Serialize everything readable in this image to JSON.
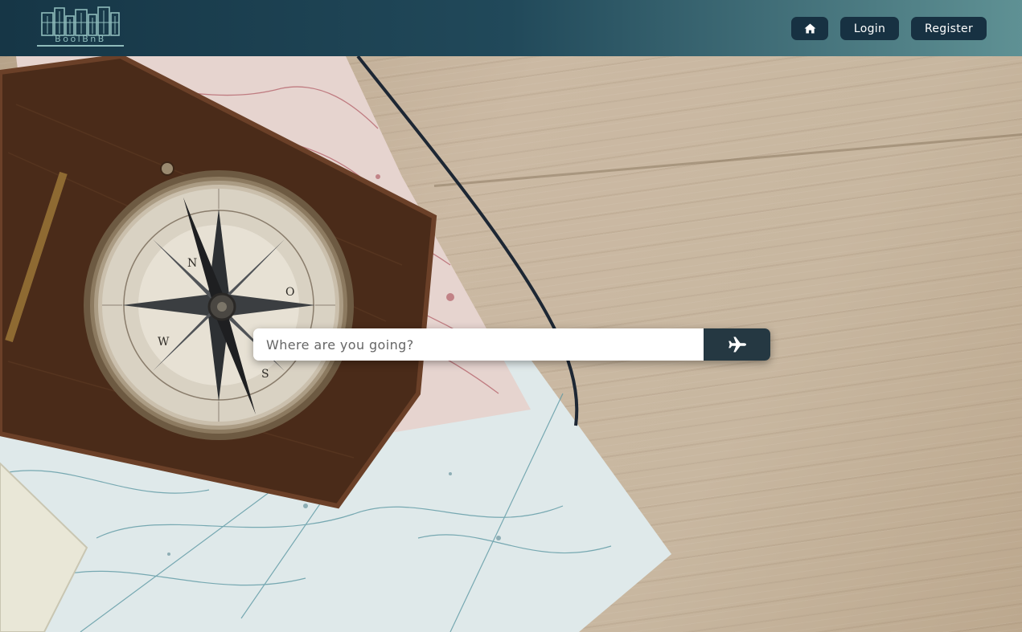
{
  "brand": {
    "logo_text": "BoolBnB",
    "icon": "city-skyline-logo",
    "color": "#8fbcbc"
  },
  "nav": {
    "home_icon": "home-icon",
    "login_label": "Login",
    "register_label": "Register",
    "button_bg": "#173142"
  },
  "search": {
    "placeholder": "Where are you going?",
    "value": "",
    "submit_icon": "plane-icon"
  },
  "colors": {
    "navbar_start": "#163646",
    "navbar_end": "#5f9194",
    "search_button": "#253842"
  }
}
